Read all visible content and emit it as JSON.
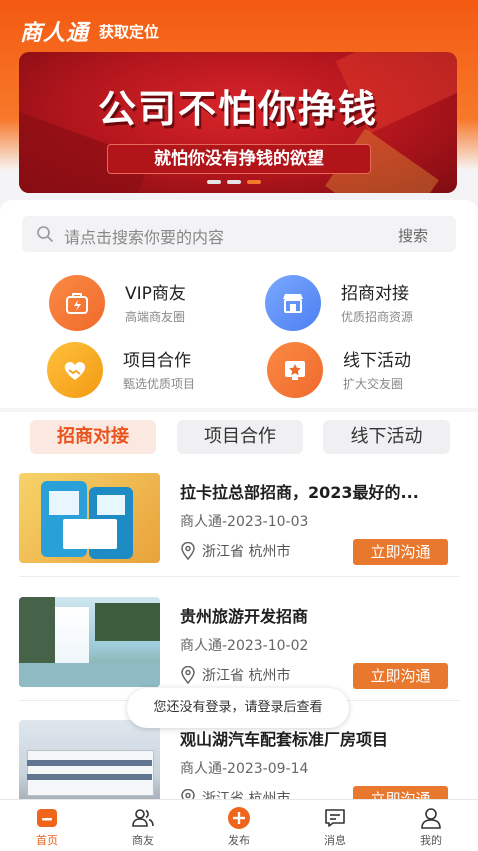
{
  "header": {
    "app_name": "商人通",
    "location_label": "获取定位"
  },
  "banner": {
    "title": "公司不怕你挣钱",
    "subtitle": "就怕你没有挣钱的欲望",
    "slide_count": 3,
    "active_slide": 3
  },
  "search": {
    "placeholder": "请点击搜索你要的内容",
    "button_label": "搜索"
  },
  "categories": [
    {
      "title": "VIP商友",
      "subtitle": "高端商友圈",
      "icon": "bag-lightning-icon",
      "color": "#f47a3a"
    },
    {
      "title": "招商对接",
      "subtitle": "优质招商资源",
      "icon": "storefront-icon",
      "color": "#5b8ff2"
    },
    {
      "title": "项目合作",
      "subtitle": "甄选优质项目",
      "icon": "handshake-heart-icon",
      "color": "#f5a21a"
    },
    {
      "title": "线下活动",
      "subtitle": "扩大交友圈",
      "icon": "star-board-icon",
      "color": "#f47a3a"
    }
  ],
  "tabs": [
    {
      "label": "招商对接",
      "active": true
    },
    {
      "label": "项目合作",
      "active": false
    },
    {
      "label": "线下活动",
      "active": false
    }
  ],
  "listings": [
    {
      "title": "拉卡拉总部招商，2023最好的...",
      "meta": "商人通-2023-10-03",
      "location": "浙江省 杭州市",
      "button": "立即沟通",
      "image": "pos-terminals"
    },
    {
      "title": "贵州旅游开发招商",
      "meta": "商人通-2023-10-02",
      "location": "浙江省 杭州市",
      "button": "立即沟通",
      "image": "waterfall"
    },
    {
      "title": "观山湖汽车配套标准厂房项目",
      "meta": "商人通-2023-09-14",
      "location": "浙江省 杭州市",
      "button": "立即沟通",
      "image": "factory-building"
    }
  ],
  "toast": {
    "text": "您还没有登录，请登录后查看"
  },
  "tabbar": [
    {
      "label": "首页",
      "icon": "home-icon",
      "active": true
    },
    {
      "label": "商友",
      "icon": "friends-icon",
      "active": false
    },
    {
      "label": "发布",
      "icon": "publish-plus-icon",
      "active": false
    },
    {
      "label": "消息",
      "icon": "message-icon",
      "active": false
    },
    {
      "label": "我的",
      "icon": "profile-icon",
      "active": false
    }
  ]
}
